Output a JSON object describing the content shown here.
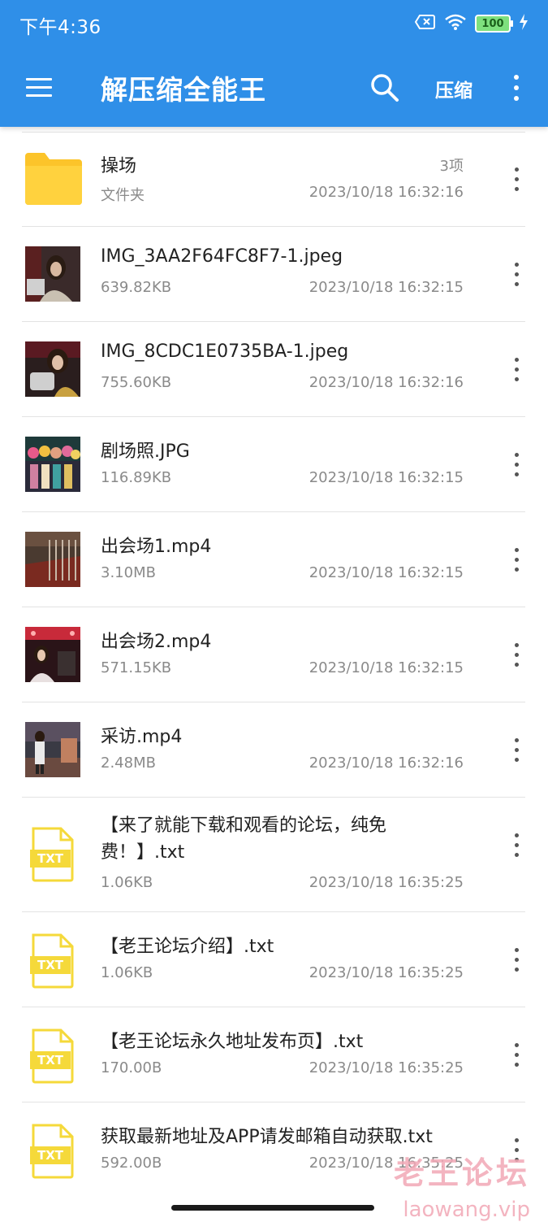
{
  "status_bar": {
    "time": "下午4:36",
    "battery": "100"
  },
  "toolbar": {
    "title": "解压缩全能王",
    "compress_label": "压缩"
  },
  "files": [
    {
      "name": "操场",
      "meta": "文件夹",
      "count": "3项",
      "date": "2023/10/18 16:32:16",
      "kind": "folder"
    },
    {
      "name": "IMG_3AA2F64FC8F7-1.jpeg",
      "meta": "639.82KB",
      "date": "2023/10/18 16:32:15",
      "kind": "photo"
    },
    {
      "name": "IMG_8CDC1E0735BA-1.jpeg",
      "meta": "755.60KB",
      "date": "2023/10/18 16:32:16",
      "kind": "photo"
    },
    {
      "name": "剧场照.JPG",
      "meta": "116.89KB",
      "date": "2023/10/18 16:32:15",
      "kind": "photo"
    },
    {
      "name": "出会场1.mp4",
      "meta": "3.10MB",
      "date": "2023/10/18 16:32:15",
      "kind": "video"
    },
    {
      "name": "出会场2.mp4",
      "meta": "571.15KB",
      "date": "2023/10/18 16:32:15",
      "kind": "video"
    },
    {
      "name": "采访.mp4",
      "meta": "2.48MB",
      "date": "2023/10/18 16:32:16",
      "kind": "video"
    },
    {
      "name": "【来了就能下载和观看的论坛，纯免费！】.txt",
      "meta": "1.06KB",
      "date": "2023/10/18 16:35:25",
      "kind": "txt"
    },
    {
      "name": "【老王论坛介绍】.txt",
      "meta": "1.06KB",
      "date": "2023/10/18 16:35:25",
      "kind": "txt"
    },
    {
      "name": "【老王论坛永久地址发布页】.txt",
      "meta": "170.00B",
      "date": "2023/10/18 16:35:25",
      "kind": "txt"
    },
    {
      "name": "获取最新地址及APP请发邮箱自动获取.txt",
      "meta": "592.00B",
      "date": "2023/10/18 16:35:25",
      "kind": "txt"
    }
  ],
  "txt_icon_label": "TXT",
  "watermark": {
    "cn": "老王论坛",
    "en": "laowang.vip"
  },
  "colors": {
    "primary": "#2f8fe8",
    "folder": "#fcc42a",
    "txt": "#f5d93a"
  }
}
